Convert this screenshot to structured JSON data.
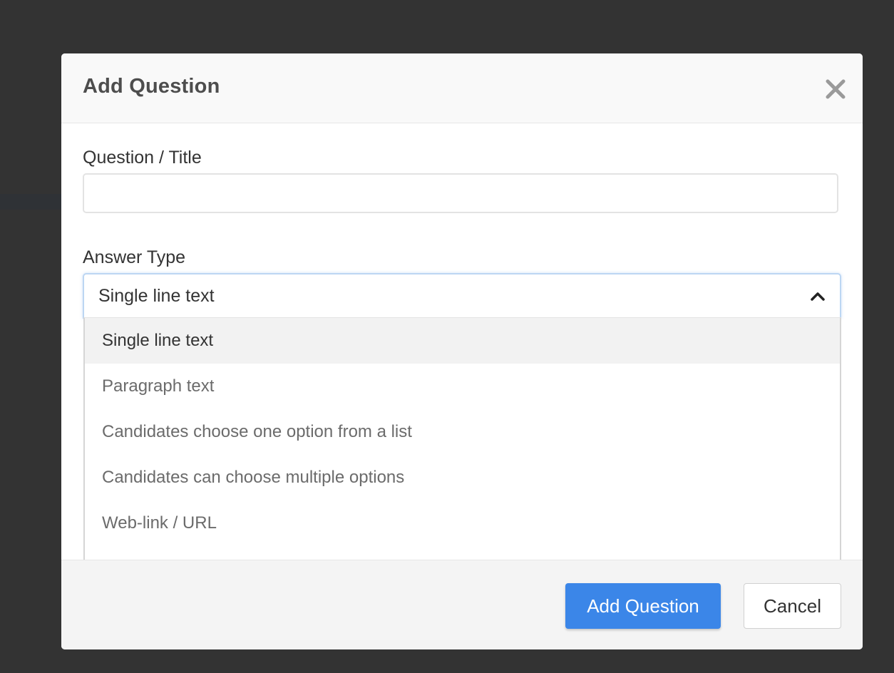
{
  "modal": {
    "title": "Add Question",
    "close_icon": "close-icon"
  },
  "form": {
    "question_label": "Question / Title",
    "question_value": "",
    "question_placeholder": "",
    "answer_type_label": "Answer Type",
    "answer_type_selected": "Single line text",
    "answer_type_expanded": true,
    "answer_type_options": [
      "Single line text",
      "Paragraph text",
      "Candidates choose one option from a list",
      "Candidates can choose multiple options",
      "Web-link / URL"
    ]
  },
  "footer": {
    "submit_label": "Add Question",
    "cancel_label": "Cancel"
  },
  "colors": {
    "backdrop": "#333333",
    "primary": "#3b86e8",
    "option_highlight": "#f2f2f2",
    "select_focus_border": "#bcd6f3"
  },
  "icons": {
    "close": "close-icon",
    "dropdown": "chevron-up-icon"
  }
}
